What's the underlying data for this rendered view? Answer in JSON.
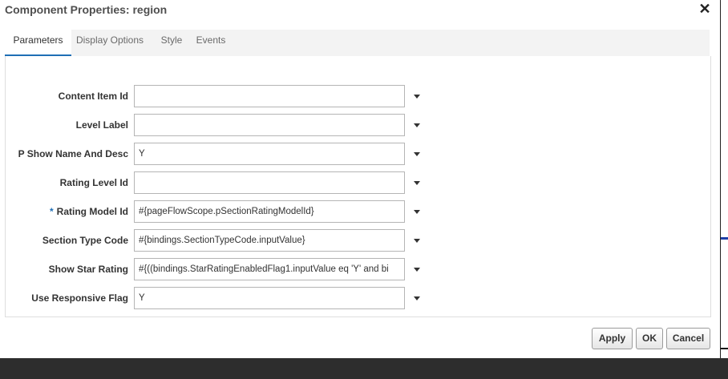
{
  "dialog": {
    "title": "Component Properties: region",
    "close_glyph": "✕"
  },
  "tabs": [
    {
      "label": "Parameters",
      "active": true
    },
    {
      "label": "Display Options",
      "active": false
    },
    {
      "label": "Style",
      "active": false
    },
    {
      "label": "Events",
      "active": false
    }
  ],
  "parameters": [
    {
      "label": "Content Item Id",
      "value": "",
      "required": false
    },
    {
      "label": "Level Label",
      "value": "",
      "required": false
    },
    {
      "label": "P Show Name And Desc",
      "value": "Y",
      "required": false
    },
    {
      "label": "Rating Level Id",
      "value": "",
      "required": false
    },
    {
      "label": "Rating Model Id",
      "value": "#{pageFlowScope.pSectionRatingModelId}",
      "required": true
    },
    {
      "label": "Section Type Code",
      "value": "#{bindings.SectionTypeCode.inputValue}",
      "required": false
    },
    {
      "label": "Show Star Rating",
      "value": "#{((bindings.StarRatingEnabledFlag1.inputValue eq 'Y' and bi",
      "required": false
    },
    {
      "label": "Use Responsive Flag",
      "value": "Y",
      "required": false
    }
  ],
  "required_marker": "*",
  "buttons": {
    "apply": "Apply",
    "ok": "OK",
    "cancel": "Cancel"
  },
  "colors": {
    "accent": "#1f6fb5",
    "title_text": "#4f4f4f"
  }
}
